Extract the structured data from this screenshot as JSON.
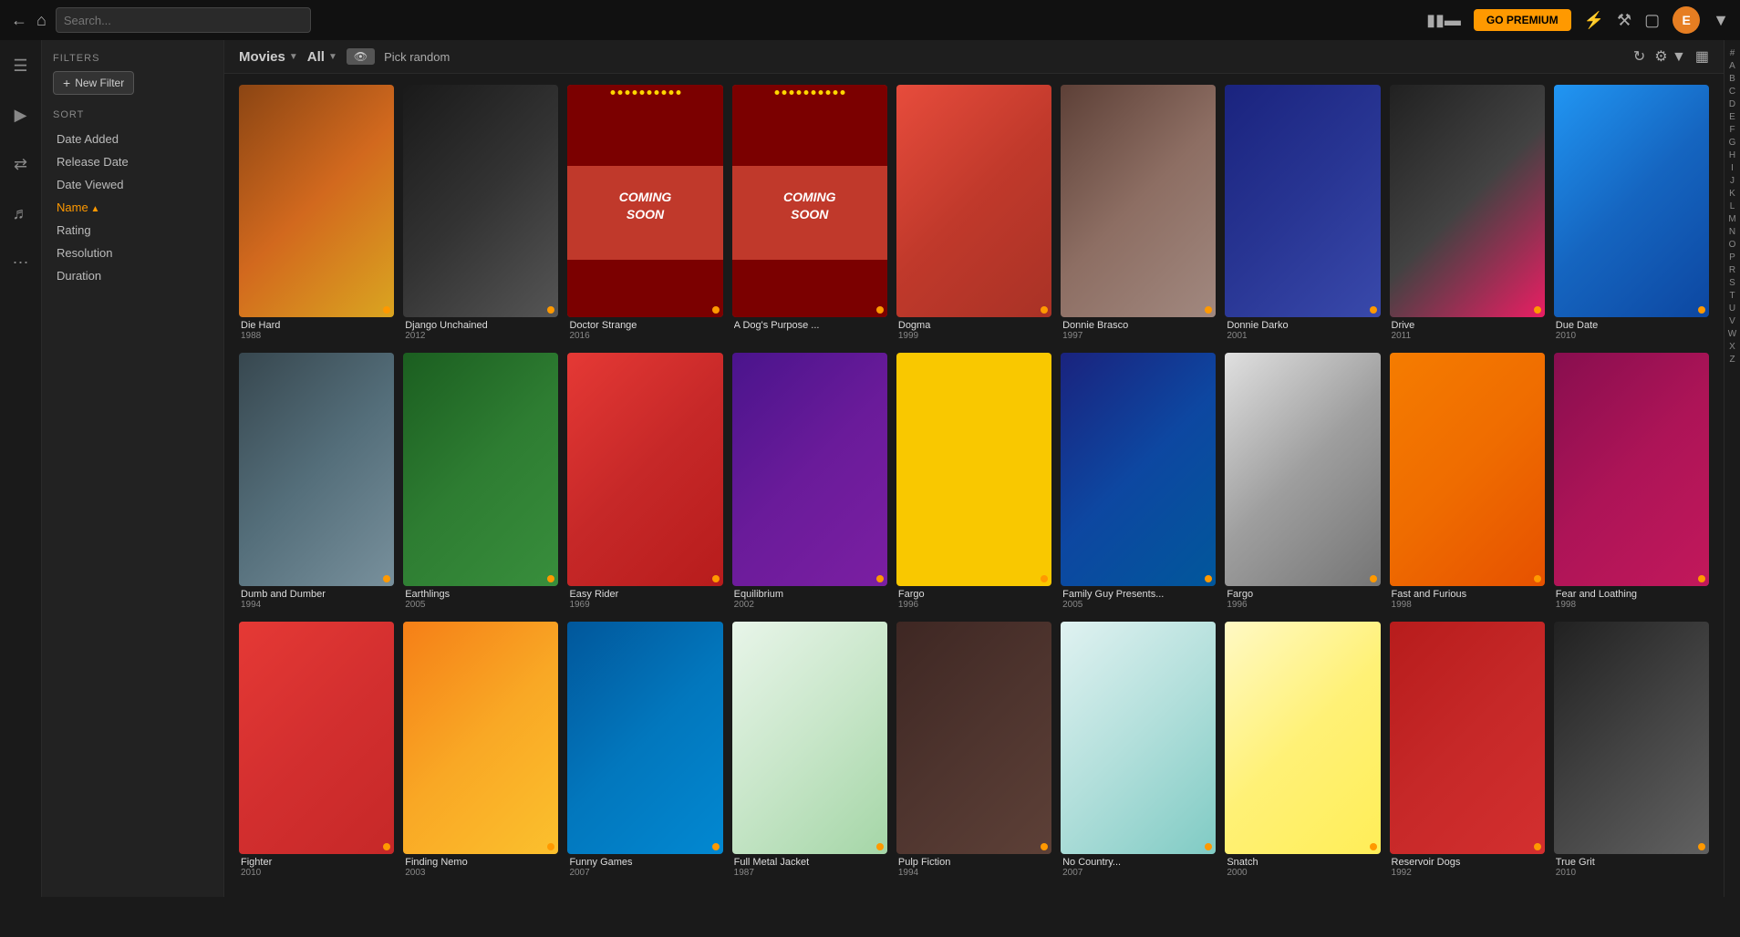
{
  "topbar": {
    "search_placeholder": "Search...",
    "premium_label": "GO PREMIUM",
    "avatar_letter": "E"
  },
  "left_nav": {
    "icons": [
      "☰",
      "▶",
      "⇄",
      "♪",
      "…"
    ]
  },
  "sidebar": {
    "filters_title": "FILTERS",
    "new_filter_label": "New Filter",
    "sort_title": "SORT",
    "sort_items": [
      {
        "label": "Date Added",
        "active": false
      },
      {
        "label": "Release Date",
        "active": false
      },
      {
        "label": "Date Viewed",
        "active": false
      },
      {
        "label": "Name",
        "active": true
      },
      {
        "label": "Rating",
        "active": false
      },
      {
        "label": "Resolution",
        "active": false
      },
      {
        "label": "Duration",
        "active": false
      }
    ]
  },
  "toolbar": {
    "movies_label": "Movies",
    "all_label": "All",
    "pick_random_label": "Pick random"
  },
  "alpha_nav": [
    "#",
    "A",
    "B",
    "C",
    "D",
    "E",
    "F",
    "G",
    "H",
    "I",
    "J",
    "K",
    "L",
    "M",
    "N",
    "O",
    "P",
    "R",
    "S",
    "T",
    "U",
    "V",
    "W",
    "X",
    "Z"
  ],
  "movies": [
    {
      "title": "Die Hard",
      "year": "1988",
      "poster_class": "poster-1"
    },
    {
      "title": "Django Unchained",
      "year": "2012",
      "poster_class": "poster-2"
    },
    {
      "title": "Doctor Strange",
      "year": "2016",
      "poster_class": "poster-3",
      "coming_soon": true
    },
    {
      "title": "A Dog's Purpose ...",
      "year": "",
      "poster_class": "poster-4",
      "coming_soon": true
    },
    {
      "title": "Dogma",
      "year": "1999",
      "poster_class": "poster-5"
    },
    {
      "title": "Donnie Brasco",
      "year": "1997",
      "poster_class": "poster-6"
    },
    {
      "title": "Donnie Darko",
      "year": "2001",
      "poster_class": "poster-7"
    },
    {
      "title": "Drive",
      "year": "2011",
      "poster_class": "poster-8"
    },
    {
      "title": "Due Date",
      "year": "2010",
      "poster_class": "poster-9"
    },
    {
      "title": "Dumb and Dumber",
      "year": "1994",
      "poster_class": "poster-10"
    },
    {
      "title": "Earthlings",
      "year": "2005",
      "poster_class": "poster-11"
    },
    {
      "title": "Easy Rider",
      "year": "1969",
      "poster_class": "poster-12"
    },
    {
      "title": "Equilibrium",
      "year": "2002",
      "poster_class": "poster-13"
    },
    {
      "title": "Fargo",
      "year": "1996",
      "poster_class": "poster-14"
    },
    {
      "title": "Family Guy Presents...",
      "year": "2005",
      "poster_class": "poster-15"
    },
    {
      "title": "Fargo",
      "year": "1996",
      "poster_class": "poster-16"
    },
    {
      "title": "Fast and Furious",
      "year": "1998",
      "poster_class": "poster-17"
    },
    {
      "title": "Fear and Loathing",
      "year": "1998",
      "poster_class": "poster-18"
    },
    {
      "title": "Fighter",
      "year": "2010",
      "poster_class": "poster-19"
    },
    {
      "title": "Finding Nemo",
      "year": "2003",
      "poster_class": "poster-20"
    },
    {
      "title": "Funny Games",
      "year": "2007",
      "poster_class": "poster-21"
    },
    {
      "title": "Full Metal Jacket",
      "year": "1987",
      "poster_class": "poster-22"
    },
    {
      "title": "Pulp Fiction",
      "year": "1994",
      "poster_class": "poster-23"
    },
    {
      "title": "No Country...",
      "year": "2007",
      "poster_class": "poster-24"
    },
    {
      "title": "Snatch",
      "year": "2000",
      "poster_class": "poster-25"
    },
    {
      "title": "Reservoir Dogs",
      "year": "1992",
      "poster_class": "poster-26"
    },
    {
      "title": "True Grit",
      "year": "2010",
      "poster_class": "poster-27"
    }
  ]
}
